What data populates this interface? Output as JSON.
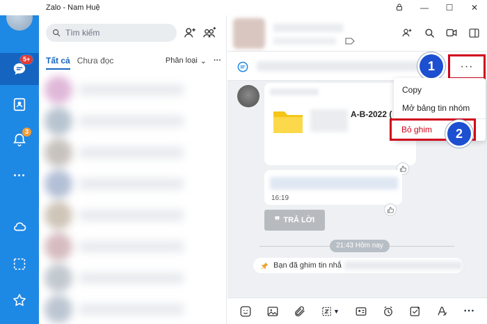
{
  "window": {
    "title": "Zalo - Nam Huệ"
  },
  "nav": {
    "chat_badge": "5+",
    "notification_badge": "3",
    "more_label": "···"
  },
  "sidebar": {
    "search_placeholder": "Tìm kiếm",
    "tabs": {
      "all": "Tất cả",
      "unread": "Chưa đọc"
    },
    "classify": "Phân loại",
    "more": "···"
  },
  "chat": {
    "pin_more": "···",
    "menu": {
      "copy": "Copy",
      "open_board": "Mở bảng tin nhóm",
      "unpin": "Bỏ ghim"
    },
    "callouts": [
      "1",
      "2"
    ],
    "file_name": "A-B-2022 ( C",
    "message_time": "16:19",
    "reply_button": "TRẢ LỜI",
    "reply_quote": "❞",
    "separator_time": "21:43 Hôm nay",
    "pin_notice": "Bạn đã ghim tin nhắ"
  },
  "colors": {
    "brand_blue": "#1e88e5",
    "highlight_red": "#d0021b",
    "callout_blue": "#1d4fd1"
  }
}
